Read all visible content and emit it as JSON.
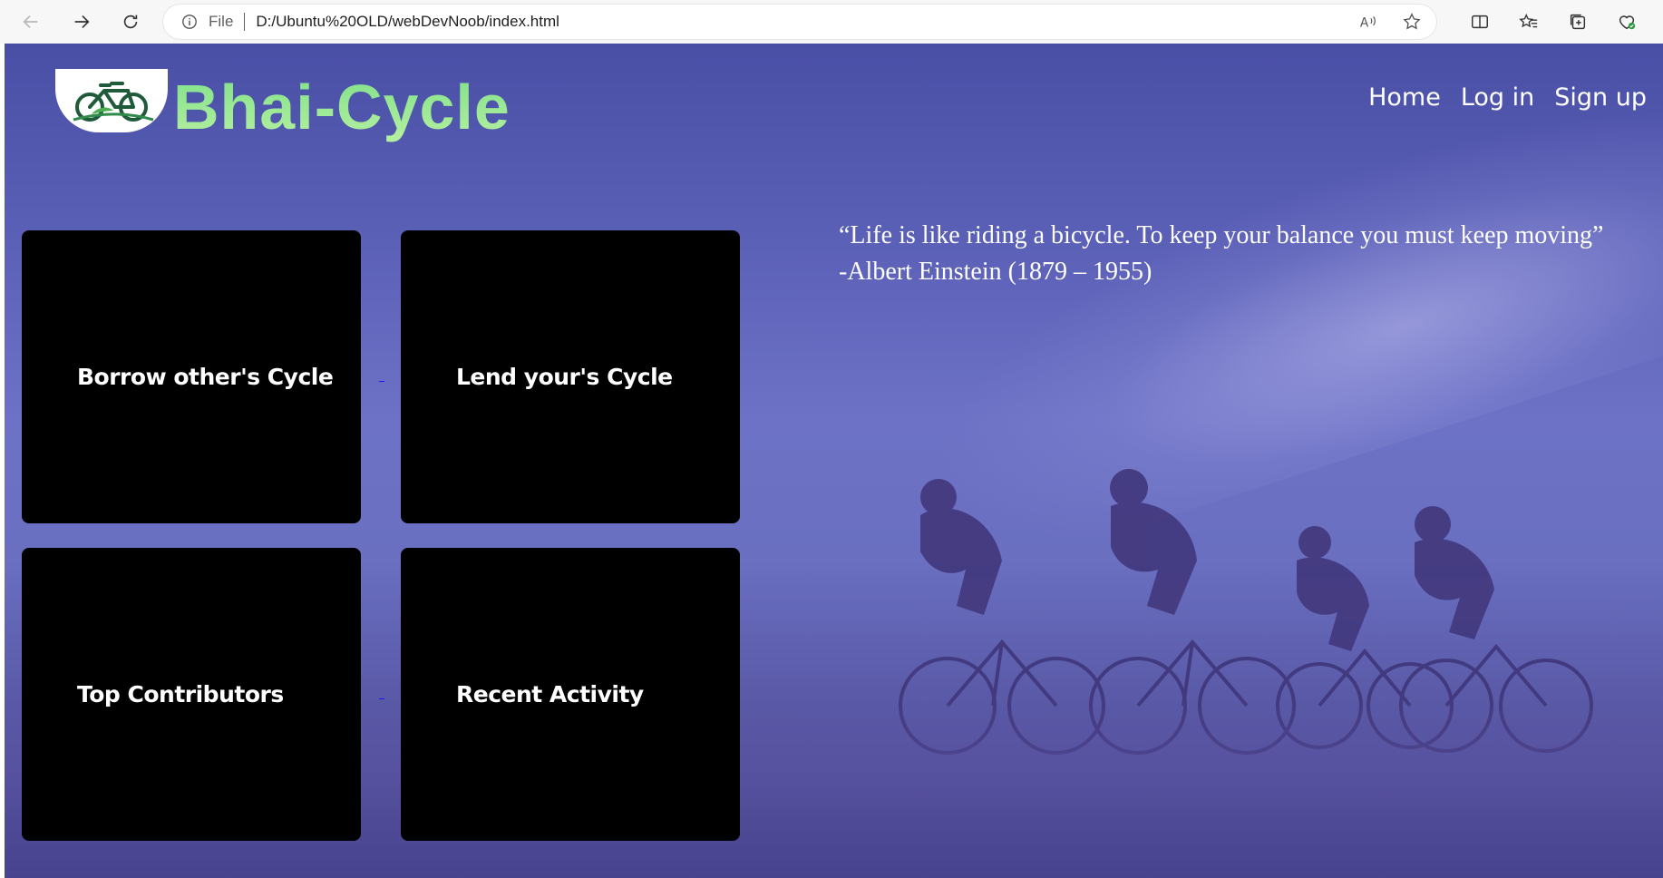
{
  "browser": {
    "scheme": "File",
    "url": "D:/Ubuntu%20OLD/webDevNoob/index.html",
    "icons": [
      "back-icon",
      "forward-icon",
      "refresh-icon",
      "info-icon",
      "read-aloud-icon",
      "favorite-star-icon",
      "split-screen-icon",
      "favorites-icon",
      "collections-icon",
      "browser-essentials-icon"
    ]
  },
  "site": {
    "brand": "Bhai-Cycle",
    "logo_icon": "bicycle-logo",
    "nav": {
      "home": "Home",
      "login": "Log in",
      "signup": "Sign up"
    }
  },
  "cards": {
    "borrow": "Borrow other's Cycle",
    "lend": "Lend your's Cycle",
    "contributors": "Top Contributors",
    "activity": "Recent Activity"
  },
  "quote": {
    "text": "“Life is like riding a bicycle. To keep your balance you must keep moving”",
    "author": "-Albert Einstein (1879 – 1955)"
  },
  "colors": {
    "brand_green": "#8ee69a",
    "card_bg": "#000000",
    "hero_purple": "#5a5fb6"
  }
}
